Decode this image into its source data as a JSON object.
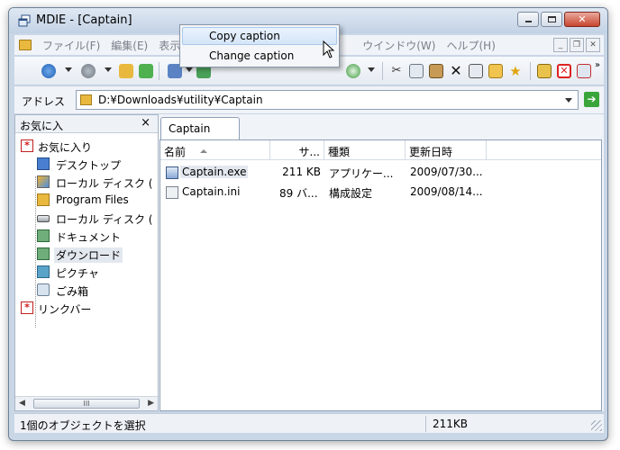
{
  "window": {
    "title": "MDIE - [Captain]",
    "icon": "explorer-window-icon"
  },
  "menubar": {
    "items": [
      "ファイル(F)",
      "編集(E)",
      "表示",
      "ウインドウ(W)",
      "ヘルプ(H)"
    ]
  },
  "address": {
    "label": "アドレス",
    "value": "D:¥Downloads¥utility¥Captain"
  },
  "left_pane": {
    "title": "お気に入",
    "close_glyph": "×",
    "items": [
      {
        "label": "お気に入り",
        "icon": "favorites-icon"
      },
      {
        "label": "デスクトップ",
        "icon": "desktop-icon"
      },
      {
        "label": "ローカル ディスク (",
        "icon": "local-disk-icon"
      },
      {
        "label": "Program Files",
        "icon": "folder-icon"
      },
      {
        "label": "ローカル ディスク (",
        "icon": "drive-icon"
      },
      {
        "label": "ドキュメント",
        "icon": "documents-icon"
      },
      {
        "label": "ダウンロード",
        "icon": "downloads-icon"
      },
      {
        "label": "ピクチャ",
        "icon": "pictures-icon"
      },
      {
        "label": "ごみ箱",
        "icon": "recycle-bin-icon"
      },
      {
        "label": "リンクバー",
        "icon": "links-icon"
      }
    ],
    "scroll_thumb": "III"
  },
  "tab": {
    "label": "Captain"
  },
  "file_list": {
    "columns": [
      "名前",
      "サ...",
      "種類",
      "更新日時"
    ],
    "rows": [
      {
        "name": "Captain.exe",
        "size": "211 KB",
        "type": "アプリケー...",
        "modified": "2009/07/30..."
      },
      {
        "name": "Captain.ini",
        "size": "89 バ...",
        "type": "構成設定",
        "modified": "2009/08/14..."
      }
    ]
  },
  "statusbar": {
    "selection": "1個のオブジェクトを選択",
    "size": "211KB"
  },
  "popup_menu": {
    "items": [
      "Copy caption",
      "Change caption"
    ]
  },
  "colors": {
    "accent": "#4a7fd0",
    "selection": "#e3e8ef",
    "frame": "#c9d6e6"
  }
}
